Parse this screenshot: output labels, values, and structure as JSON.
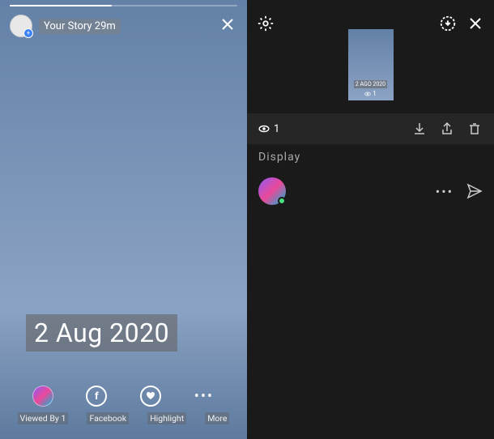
{
  "left": {
    "storyLabel": "Your Story 29m",
    "dateOverlay": "2 Aug 2020",
    "viewedByLabel": "Viewed By 1",
    "facebookLabel": "Facebook",
    "highlightLabel": "Highlight",
    "moreLabel": "More",
    "fbGlyph": "f"
  },
  "right": {
    "thumbDate": "2 AGO 2020",
    "thumbViews": "1",
    "viewCount": "1",
    "displayLabel": "Display"
  }
}
